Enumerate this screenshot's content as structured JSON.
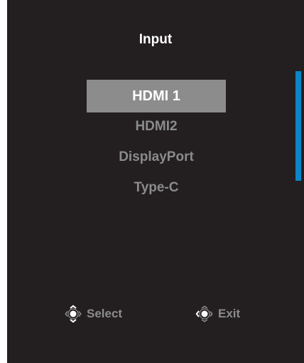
{
  "osd": {
    "title": "Input",
    "inputs": [
      {
        "label": "HDMI 1",
        "selected": true
      },
      {
        "label": "HDMI2",
        "selected": false
      },
      {
        "label": "DisplayPort",
        "selected": false
      },
      {
        "label": "Type-C",
        "selected": false
      }
    ],
    "footer": {
      "select_label": "Select",
      "select_icon": "joystick-up-down-icon",
      "exit_label": "Exit",
      "exit_icon": "joystick-left-icon"
    },
    "colors": {
      "background": "#231f20",
      "highlight": "#8c8c8c",
      "text": "#ffffff",
      "muted_text": "#8b8b8b",
      "scrollbar": "#0a86c6"
    }
  }
}
